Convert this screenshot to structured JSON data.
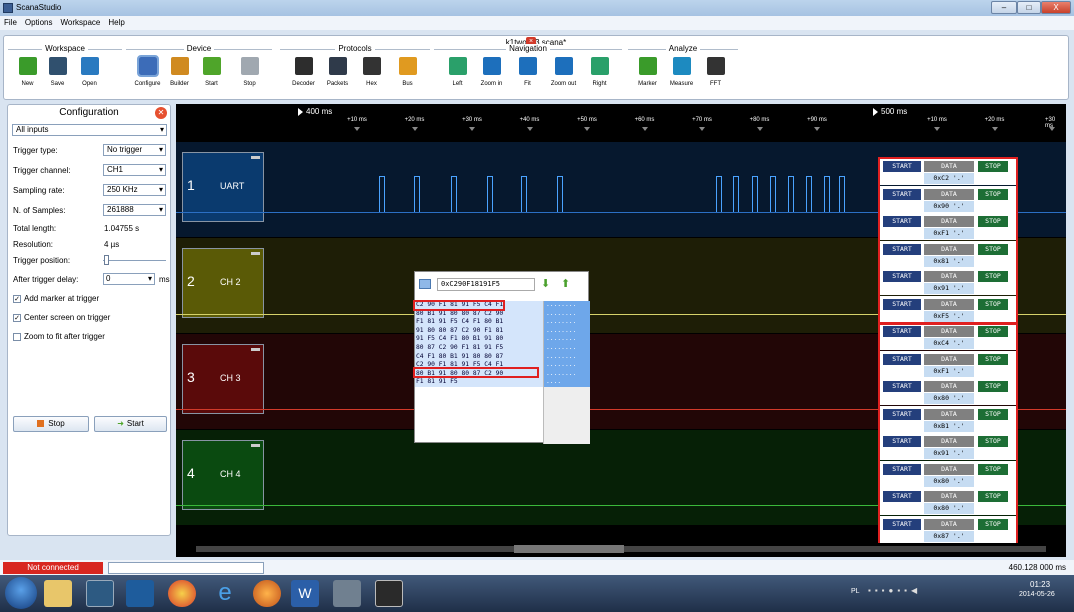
{
  "window": {
    "app_title": "ScanaStudio",
    "min": "–",
    "max": "□",
    "close": "X"
  },
  "menu": [
    "File",
    "Options",
    "Workspace",
    "Help"
  ],
  "doc_title": "k1twody3.scana*",
  "toolbar": {
    "groups": {
      "workspace": "Workspace",
      "device": "Device",
      "protocols": "Protocols",
      "navigation": "Navigation",
      "analyze": "Analyze"
    },
    "buttons": [
      {
        "label": "New",
        "icon": "plus-icon",
        "color": "#3a9b2a"
      },
      {
        "label": "Save",
        "icon": "save-icon",
        "color": "#30506e"
      },
      {
        "label": "Open",
        "icon": "folder-icon",
        "color": "#2a7ac0"
      },
      {
        "label": "Configure",
        "icon": "sl2-device-icon",
        "color": "#3c6cb8"
      },
      {
        "label": "Builder",
        "icon": "wand-icon",
        "color": "#d08a20"
      },
      {
        "label": "Start",
        "icon": "arrow-right-icon",
        "color": "#4fa52a"
      },
      {
        "label": "Stop",
        "icon": "stop-icon",
        "color": "#a0a8b0"
      },
      {
        "label": "Decoder",
        "icon": "decoder-icon",
        "color": "#2d2d2d"
      },
      {
        "label": "Packets",
        "icon": "packets-icon",
        "color": "#2f3a4a"
      },
      {
        "label": "Hex",
        "icon": "hex-icon",
        "color": "#333"
      },
      {
        "label": "Bus",
        "icon": "bus-icon",
        "color": "#e09a20"
      },
      {
        "label": "Left",
        "icon": "arrow-left-icon",
        "color": "#2aa06a"
      },
      {
        "label": "Zoom in",
        "icon": "zoom-in-icon",
        "color": "#1d6fbc"
      },
      {
        "label": "Fit",
        "icon": "fit-icon",
        "color": "#1d6fbc"
      },
      {
        "label": "Zoom out",
        "icon": "zoom-out-icon",
        "color": "#1d6fbc"
      },
      {
        "label": "Right",
        "icon": "arrow-right-icon",
        "color": "#2aa06a"
      },
      {
        "label": "Marker",
        "icon": "flag-icon",
        "color": "#3a9b2a"
      },
      {
        "label": "Measure",
        "icon": "measure-icon",
        "color": "#1d8ac0"
      },
      {
        "label": "FFT",
        "icon": "fft-icon",
        "color": "#333"
      }
    ]
  },
  "config": {
    "title": "Configuration",
    "inputs_select": "All inputs",
    "trigger_type_label": "Trigger type:",
    "trigger_type": "No trigger",
    "trigger_channel_label": "Trigger channel:",
    "trigger_channel": "CH1",
    "sampling_rate_label": "Sampling rate:",
    "sampling_rate": "250 KHz",
    "samples_label": "N. of Samples:",
    "samples": "261888",
    "total_length_label": "Total length:",
    "total_length": "1.04755 s",
    "resolution_label": "Resolution:",
    "resolution": "4 µs",
    "trigger_position_label": "Trigger position:",
    "after_delay_label": "After trigger delay:",
    "after_delay": "0",
    "after_delay_unit": "ms",
    "add_marker": "Add marker at trigger",
    "center_screen": "Center screen on trigger",
    "zoom_fit": "Zoom to fit after trigger",
    "stop_btn": "Stop",
    "start_btn": "Start"
  },
  "timeline": {
    "major1": "400 ms",
    "major2": "500 ms",
    "ticks1": [
      "+10 ms",
      "+20 ms",
      "+30 ms",
      "+40 ms",
      "+50 ms",
      "+60 ms",
      "+70 ms",
      "+80 ms",
      "+90 ms"
    ],
    "ticks2": [
      "+10 ms",
      "+20 ms",
      "+30 ms"
    ]
  },
  "channels": [
    {
      "num": "1",
      "name": "UART",
      "color": "#0a3a6e",
      "lane": "#06182e"
    },
    {
      "num": "2",
      "name": "CH 2",
      "color": "#5a5a06",
      "lane": "#1e1e06"
    },
    {
      "num": "3",
      "name": "CH 3",
      "color": "#5a0a0a",
      "lane": "#220606"
    },
    {
      "num": "4",
      "name": "CH 4",
      "color": "#0a4a10",
      "lane": "#062006"
    }
  ],
  "hex_view": {
    "address": "0xC290F18191F5",
    "rows": [
      "C2 90 F1 81 91 F5 C4 F1",
      "80 B1 91 80 80 87 C2 90",
      "F1 81 91 F5 C4 F1 80 B1",
      "91 80 80 87 C2 90 F1 81",
      "91 F5 C4 F1 80 B1 91 80",
      "80 87 C2 90 F1 81 91 F5",
      "C4 F1 80 B1 91 80 80 87",
      "C2 90 F1 81 91 F5 C4 F1",
      "80 B1 91 80 80 87 C2 90",
      "F1 81 91 F5"
    ],
    "ascii": [
      "........",
      "........",
      "........",
      "........",
      "........",
      "........",
      "........",
      "........",
      "........",
      "...."
    ]
  },
  "packets": {
    "start": "START",
    "data": "DATA",
    "stop": "STOP",
    "values": [
      "0xC2 '.'",
      "0x90 '.'",
      "0xF1 '.'",
      "0x81 '.'",
      "0x91 '.'",
      "0xF5 '.'",
      "0xC4 '.'",
      "0xF1 '.'",
      "0x80 '.'",
      "0xB1 '.'",
      "0x91 '.'",
      "0x80 '.'",
      "0x80 '.'",
      "0x87 '.'"
    ]
  },
  "status": {
    "connection": "Not connected",
    "time_readout": "460.128 000 ms"
  },
  "tray": {
    "lang": "PL",
    "time": "01:23",
    "date": "2014-05-26"
  }
}
